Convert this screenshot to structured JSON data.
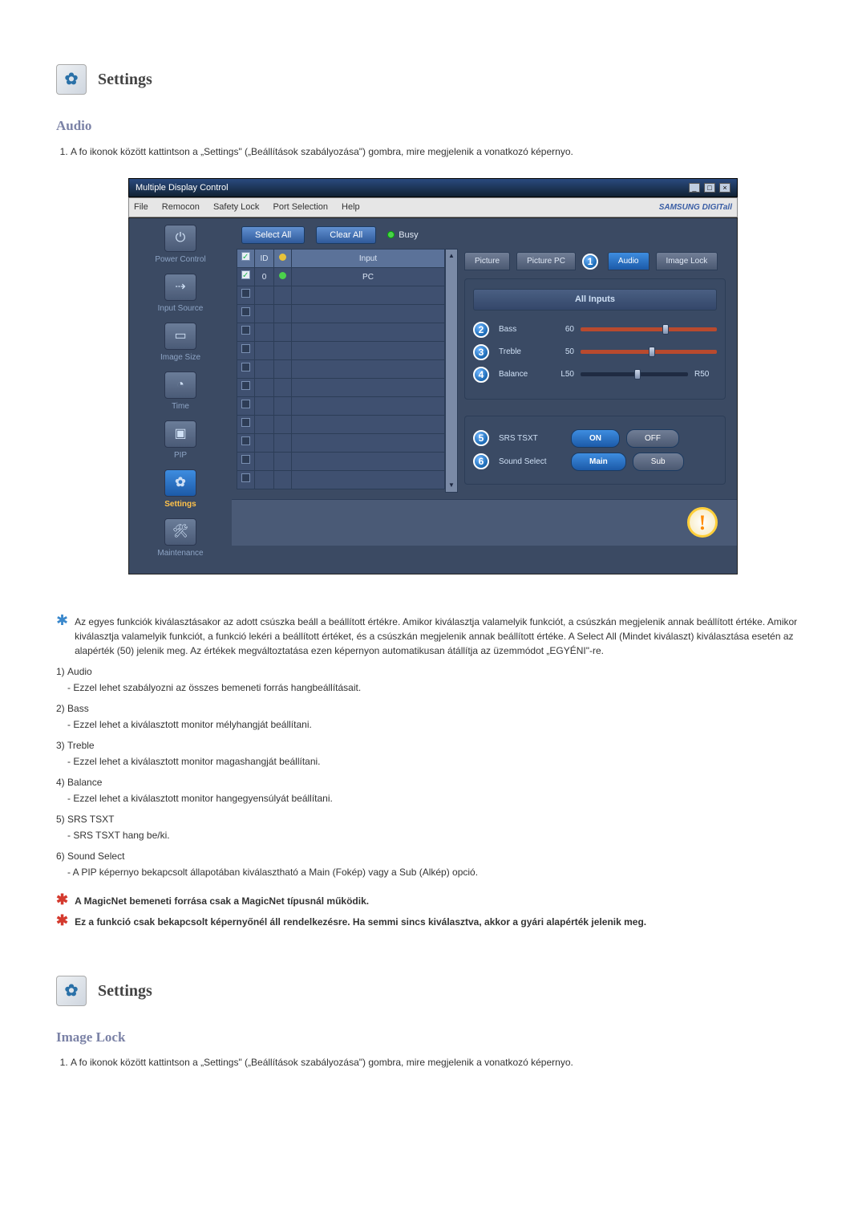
{
  "section1": {
    "header": "Settings",
    "subtitle": "Audio",
    "step": "A fo ikonok között kattintson a „Settings\" („Beállítások szabályozása\") gombra, mire megjelenik a vonatkozó képernyo."
  },
  "screenshot": {
    "window_title": "Multiple Display Control",
    "menu": {
      "file": "File",
      "remocon": "Remocon",
      "safety": "Safety Lock",
      "port": "Port Selection",
      "help": "Help"
    },
    "brand": "SAMSUNG DIGITall",
    "sidebar": {
      "power": "Power Control",
      "input": "Input Source",
      "image": "Image Size",
      "time": "Time",
      "pip": "PIP",
      "settings": "Settings",
      "maint": "Maintenance"
    },
    "toolbar": {
      "select_all": "Select All",
      "clear_all": "Clear All",
      "busy": "Busy"
    },
    "table": {
      "h_id": "ID",
      "h_input": "Input",
      "rows": [
        {
          "checked": true,
          "id": "0",
          "dot": "y",
          "input": "Input"
        },
        {
          "checked": true,
          "id": "0",
          "dot": "g",
          "input": "PC"
        }
      ],
      "empty_rows": 10
    },
    "tabs": {
      "picture": "Picture",
      "picture_pc": "Picture PC",
      "audio": "Audio",
      "image_lock": "Image Lock"
    },
    "panel": {
      "all_inputs": "All Inputs",
      "bass": {
        "label": "Bass",
        "value": "60"
      },
      "treble": {
        "label": "Treble",
        "value": "50"
      },
      "balance": {
        "label": "Balance",
        "left": "L50",
        "right": "R50"
      },
      "srs": {
        "label": "SRS TSXT",
        "on": "ON",
        "off": "OFF"
      },
      "sound": {
        "label": "Sound Select",
        "main": "Main",
        "sub": "Sub"
      }
    }
  },
  "notes": {
    "star1": "Az egyes funkciók kiválasztásakor az adott csúszka beáll a beállított értékre. Amikor kiválasztja valamelyik funkciót, a csúszkán megjelenik annak beállított értéke. Amikor kiválasztja valamelyik funkciót, a funkció lekéri a beállított értéket, és a csúszkán megjelenik annak beállított értéke. A Select All (Mindet kiválaszt) kiválasztása esetén az alapérték (50) jelenik meg. Az értékek megváltoztatása ezen képernyon automatikusan átállítja az üzemmódot „EGYÉNI\"-re.",
    "i1_t": "Audio",
    "i1_s": "- Ezzel lehet szabályozni az összes bemeneti forrás hangbeállításait.",
    "i2_t": "Bass",
    "i2_s": "- Ezzel lehet a kiválasztott monitor mélyhangját beállítani.",
    "i3_t": "Treble",
    "i3_s": "- Ezzel lehet a kiválasztott monitor magashangját beállítani.",
    "i4_t": "Balance",
    "i4_s": "- Ezzel lehet a kiválasztott monitor hangegyensúlyát beállítani.",
    "i5_t": "SRS TSXT",
    "i5_s": "- SRS TSXT hang be/ki.",
    "i6_t": "Sound Select",
    "i6_s": "- A PIP képernyo bekapcsolt állapotában kiválasztható a Main (Fokép) vagy a Sub (Alkép) opció.",
    "red1": "A MagicNet bemeneti forrása csak a MagicNet típusnál működik.",
    "red2": "Ez a funkció csak bekapcsolt képernyőnél áll rendelkezésre. Ha semmi sincs kiválasztva, akkor a gyári alapérték jelenik meg."
  },
  "section2": {
    "header": "Settings",
    "subtitle": "Image Lock",
    "step": "A fo ikonok között kattintson a „Settings\" („Beállítások szabályozása\") gombra, mire megjelenik a vonatkozó képernyo."
  },
  "labels": {
    "n1": "1)",
    "n2": "2)",
    "n3": "3)",
    "n4": "4)",
    "n5": "5)",
    "n6": "6)",
    "ord1": "1."
  }
}
